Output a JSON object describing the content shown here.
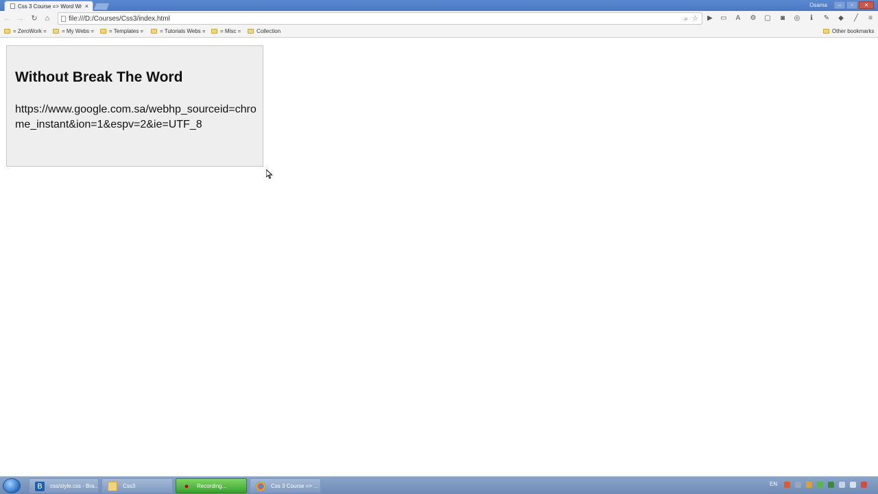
{
  "browser": {
    "tab_title": "Css 3 Course => Word Wr",
    "tab_close": "×",
    "user_name": "Osama",
    "window_buttons": {
      "minimize": "‒",
      "maximize": "▫",
      "close": "✕"
    },
    "address": "file:///D:/Courses/Css3/index.html"
  },
  "toolbar_icons": {
    "back": "←",
    "forward": "→",
    "reload": "↻",
    "home": "⌂",
    "zoom": "⌕",
    "star": "☆"
  },
  "bookmarks": {
    "items": [
      {
        "label": "= ZeroWork ="
      },
      {
        "label": "= My Webs ="
      },
      {
        "label": "= Templates ="
      },
      {
        "label": "= Tutorials Webs ="
      },
      {
        "label": "= Misc ="
      },
      {
        "label": "Collection"
      }
    ],
    "other": "Other bookmarks"
  },
  "page": {
    "heading": "Without Break The Word",
    "url_text": "https://www.google.com.sa/webhp_sourceid=chrome_instant&ion=1&espv=2&ie=UTF_8"
  },
  "taskbar": {
    "tasks": [
      {
        "label": "css/style.css - Bra..."
      },
      {
        "label": "Css3"
      },
      {
        "label": "Recording..."
      },
      {
        "label": "Css 3 Course => ..."
      }
    ],
    "lang": "EN"
  },
  "colors": {
    "titlebar": "#4a78c4",
    "content_bg": "#eeeeee",
    "recording_green": "#39a22a"
  }
}
